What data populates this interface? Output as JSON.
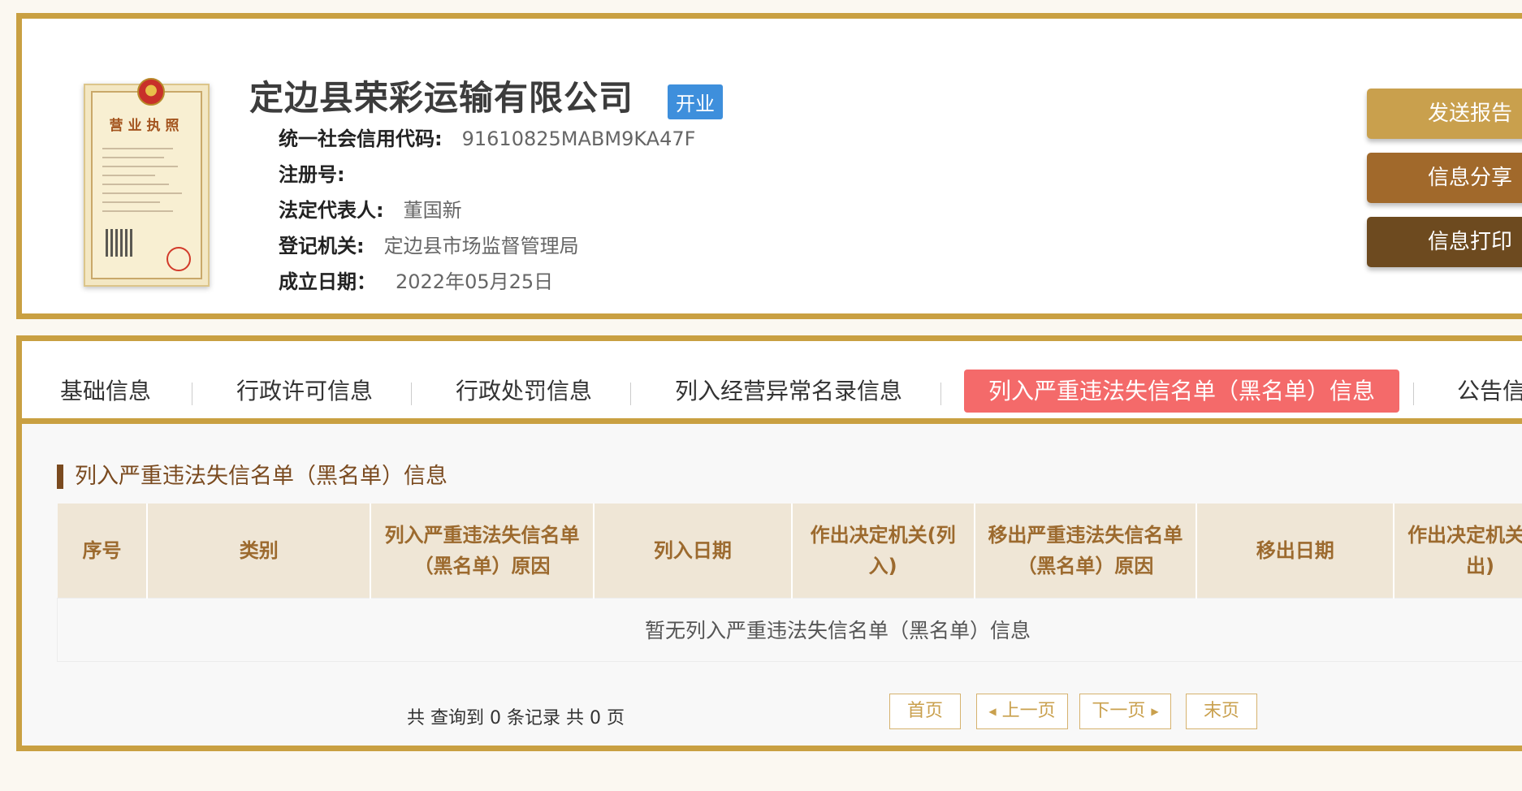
{
  "company": {
    "license_title": "营业执照",
    "name": "定边县荣彩运输有限公司",
    "status": "开业",
    "fields": [
      {
        "label": "统一社会信用代码:",
        "value": "91610825MABM9KA47F"
      },
      {
        "label": "注册号:",
        "value": ""
      },
      {
        "label": "法定代表人:",
        "value": "董国新"
      },
      {
        "label": "登记机关:",
        "value": "定边县市场监督管理局"
      },
      {
        "label": "成立日期：",
        "value": "2022年05月25日"
      }
    ]
  },
  "actions": {
    "send_report": "发送报告",
    "share": "信息分享",
    "print": "信息打印"
  },
  "tabs": [
    {
      "label": "基础信息",
      "active": false
    },
    {
      "label": "行政许可信息",
      "active": false
    },
    {
      "label": "行政处罚信息",
      "active": false
    },
    {
      "label": "列入经营异常名录信息",
      "active": false
    },
    {
      "label": "列入严重违法失信名单（黑名单）信息",
      "active": true
    },
    {
      "label": "公告信息",
      "active": false
    }
  ],
  "section": {
    "title": "列入严重违法失信名单（黑名单）信息"
  },
  "table": {
    "columns": [
      "序号",
      "类别",
      "列入严重违法失信名单（黑名单）原因",
      "列入日期",
      "作出决定机关(列入)",
      "移出严重违法失信名单（黑名单）原因",
      "移出日期",
      "作出决定机关(移出)"
    ],
    "empty_text": "暂无列入严重违法失信名单（黑名单）信息"
  },
  "pager": {
    "summary": "共 查询到 0 条记录 共 0 页",
    "first": "首页",
    "prev": "上一页",
    "next": "下一页",
    "last": "末页"
  },
  "colors": {
    "gold_border": "#c9a042",
    "badge_blue": "#3e8fdc",
    "active_tab": "#f46a6a",
    "btn_send": "#c9a04d",
    "btn_share": "#a1692b",
    "btn_print": "#6d4a1f"
  }
}
